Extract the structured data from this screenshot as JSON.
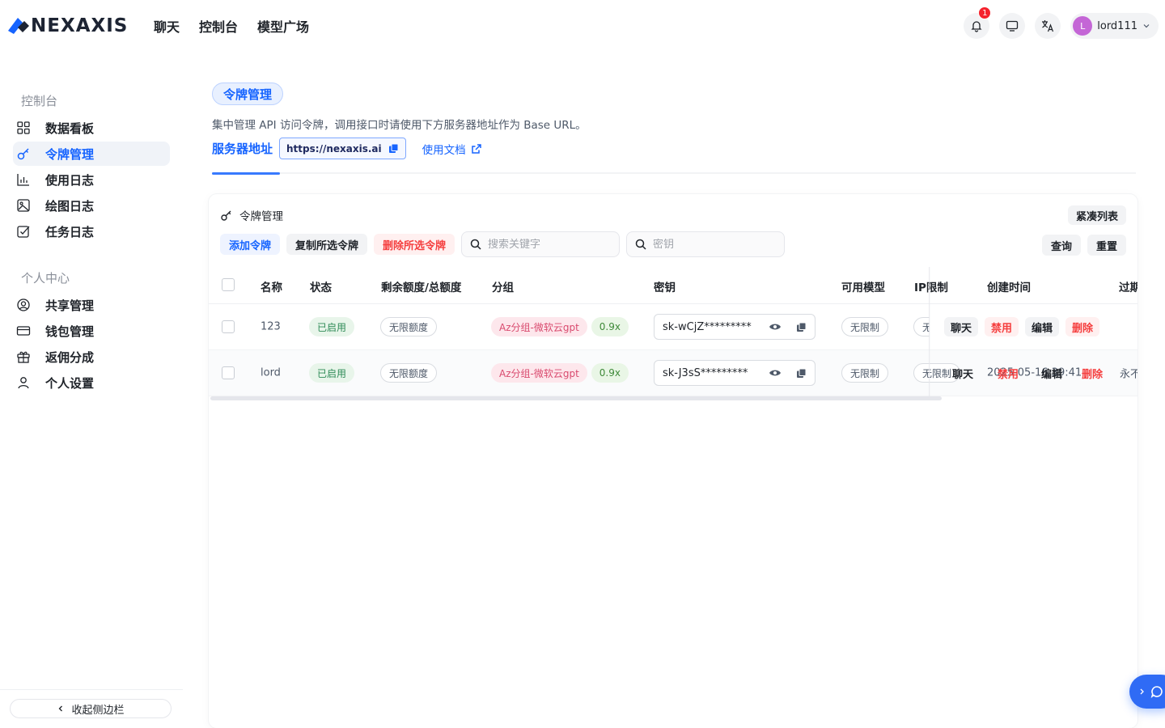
{
  "brand": {
    "name": "NEXAXIS"
  },
  "topnav": {
    "chat": "聊天",
    "console": "控制台",
    "models": "模型广场"
  },
  "topright": {
    "notification_count": "1",
    "user_initial": "L",
    "user_name": "lord111"
  },
  "sidebar": {
    "section1": "控制台",
    "items1": [
      {
        "label": "数据看板"
      },
      {
        "label": "令牌管理"
      },
      {
        "label": "使用日志"
      },
      {
        "label": "绘图日志"
      },
      {
        "label": "任务日志"
      }
    ],
    "section2": "个人中心",
    "items2": [
      {
        "label": "共享管理"
      },
      {
        "label": "钱包管理"
      },
      {
        "label": "返佣分成"
      },
      {
        "label": "个人设置"
      }
    ],
    "collapse": "收起侧边栏"
  },
  "header": {
    "title": "令牌管理",
    "description": "集中管理 API 访问令牌，调用接口时请使用下方服务器地址作为 Base URL。",
    "server_label": "服务器地址",
    "server_url": "https://nexaxis.ai",
    "docs_link": "使用文档"
  },
  "card": {
    "title": "令牌管理",
    "compact": "紧凑列表",
    "add": "添加令牌",
    "copy_selected": "复制所选令牌",
    "delete_selected": "删除所选令牌",
    "search_placeholder": "搜索关键字",
    "key_placeholder": "密钥",
    "query": "查询",
    "reset": "重置"
  },
  "table": {
    "columns": {
      "name": "名称",
      "status": "状态",
      "quota": "剩余额度/总额度",
      "group": "分组",
      "key": "密钥",
      "models": "可用模型",
      "ip": "IP限制",
      "created": "创建时间",
      "expire": "过期"
    },
    "rows": [
      {
        "name": "123",
        "status": "已启用",
        "quota": "无限额度",
        "group": "Az分组-微软云gpt",
        "ratio": "0.9x",
        "key": "sk-wCjZ*********",
        "models": "无限制",
        "ip": "无",
        "act_chat": "聊天",
        "act_disable": "禁用",
        "act_edit": "编辑",
        "act_delete": "删除"
      },
      {
        "name": "lord",
        "status": "已启用",
        "quota": "无限额度",
        "group": "Az分组-微软云gpt",
        "ratio": "0.9x",
        "key": "sk-J3sS*********",
        "models": "无限制",
        "ip": "无限制",
        "created": "2025-05-16 39:41",
        "expire": "永不",
        "act_chat": "聊天",
        "act_disable": "禁用",
        "act_edit": "编辑",
        "act_delete": "删除"
      }
    ]
  }
}
